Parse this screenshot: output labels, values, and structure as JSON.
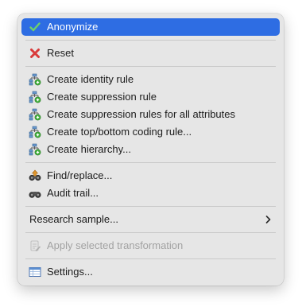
{
  "menu": {
    "anonymize_label": "Anonymize",
    "reset_label": "Reset",
    "create_identity_rule_label": "Create identity rule",
    "create_suppression_rule_label": "Create suppression rule",
    "create_suppression_rules_all_label": "Create suppression rules for all attributes",
    "create_top_bottom_label": "Create top/bottom coding rule...",
    "create_hierarchy_label": "Create hierarchy...",
    "find_replace_label": "Find/replace...",
    "audit_trail_label": "Audit trail...",
    "research_sample_label": "Research sample...",
    "apply_transformation_label": "Apply selected transformation",
    "settings_label": "Settings..."
  },
  "colors": {
    "selection": "#2e6de3",
    "menu_background": "#e6e6e6",
    "disabled_text": "#a2a2a2"
  }
}
